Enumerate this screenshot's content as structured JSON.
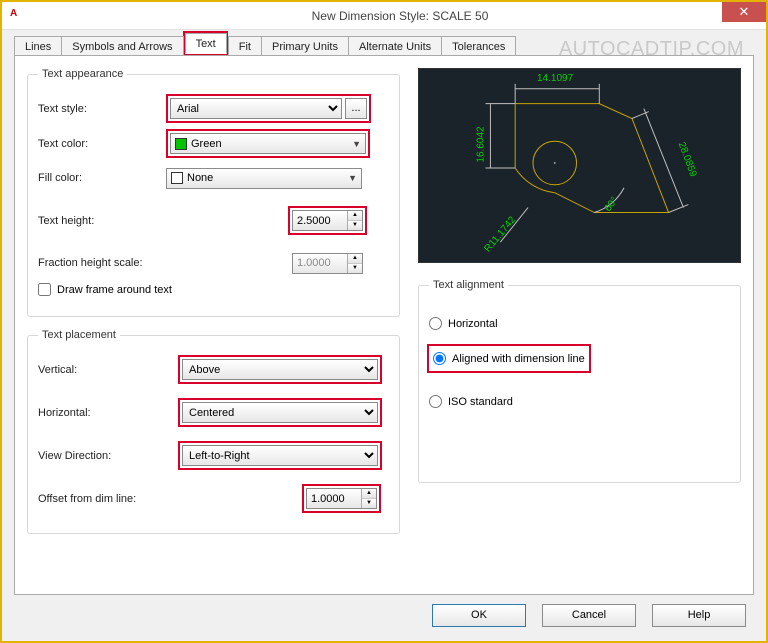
{
  "window": {
    "title": "New Dimension Style: SCALE 50"
  },
  "watermark": "AUTOCADTIP.COM",
  "tabs": {
    "lines": "Lines",
    "symbols": "Symbols and Arrows",
    "text": "Text",
    "fit": "Fit",
    "primary": "Primary Units",
    "alternate": "Alternate Units",
    "tolerances": "Tolerances"
  },
  "appearance": {
    "legend": "Text appearance",
    "style_label": "Text style:",
    "style_value": "Arial",
    "color_label": "Text color:",
    "color_value": "Green",
    "fill_label": "Fill color:",
    "fill_value": "None",
    "height_label": "Text height:",
    "height_value": "2.5000",
    "frac_label": "Fraction height scale:",
    "frac_value": "1.0000",
    "frame_label": "Draw frame around text"
  },
  "placement": {
    "legend": "Text placement",
    "vertical_label": "Vertical:",
    "vertical_value": "Above",
    "horizontal_label": "Horizontal:",
    "horizontal_value": "Centered",
    "viewdir_label": "View Direction:",
    "viewdir_value": "Left-to-Right",
    "offset_label": "Offset from dim line:",
    "offset_value": "1.0000"
  },
  "alignment": {
    "legend": "Text alignment",
    "horizontal": "Horizontal",
    "aligned": "Aligned with dimension line",
    "iso": "ISO standard"
  },
  "preview_dims": {
    "top": "14.1097",
    "left": "16.6042",
    "right": "28.0859",
    "angle": "60°",
    "radius": "R11.1742"
  },
  "buttons": {
    "ok": "OK",
    "cancel": "Cancel",
    "help": "Help",
    "ellipsis": "..."
  }
}
